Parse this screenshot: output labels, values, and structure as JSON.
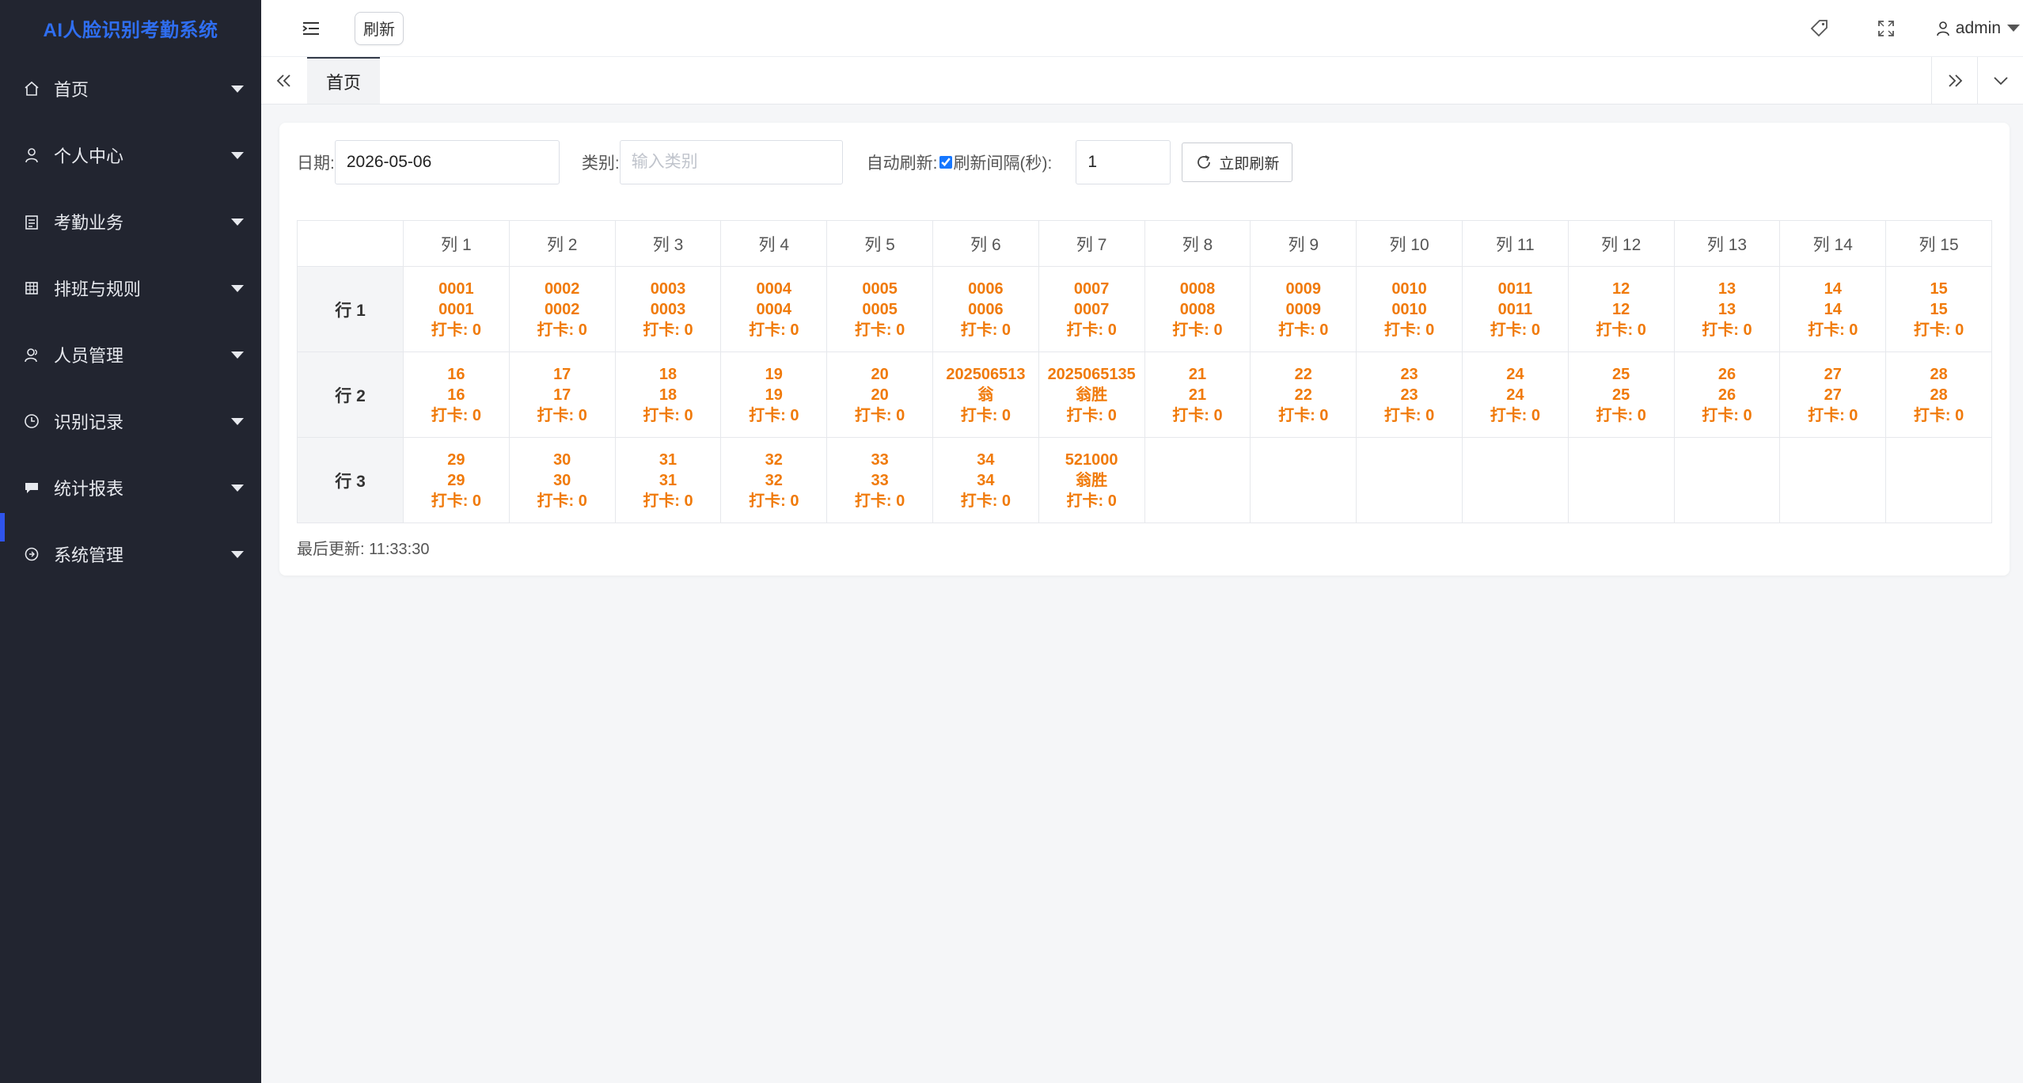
{
  "app": {
    "title": "AI人脸识别考勤系统"
  },
  "sidebar": {
    "items": [
      {
        "label": "首页",
        "icon": "home-icon"
      },
      {
        "label": "个人中心",
        "icon": "user-icon"
      },
      {
        "label": "考勤业务",
        "icon": "clipboard-icon"
      },
      {
        "label": "排班与规则",
        "icon": "grid-icon"
      },
      {
        "label": "人员管理",
        "icon": "users-icon"
      },
      {
        "label": "识别记录",
        "icon": "clock-icon"
      },
      {
        "label": "统计报表",
        "icon": "chat-icon"
      },
      {
        "label": "系统管理",
        "icon": "settings-icon"
      }
    ]
  },
  "header": {
    "refresh_label": "刷新",
    "user_name": "admin"
  },
  "tabs": [
    {
      "label": "首页"
    }
  ],
  "filters": {
    "date_label": "日期:",
    "date_value": "2026-05-06",
    "category_label": "类别:",
    "category_placeholder": "输入类别",
    "auto_refresh_label": "自动刷新:",
    "interval_label": "刷新间隔(秒):",
    "interval_value": "1",
    "refresh_now_label": "立即刷新",
    "auto_refresh_checked": true
  },
  "grid": {
    "columns": [
      "列 1",
      "列 2",
      "列 3",
      "列 4",
      "列 5",
      "列 6",
      "列 7",
      "列 8",
      "列 9",
      "列 10",
      "列 11",
      "列 12",
      "列 13",
      "列 14",
      "列 15"
    ],
    "rows": [
      {
        "label": "行 1",
        "cells": [
          [
            "0001",
            "0001",
            "打卡: 0"
          ],
          [
            "0002",
            "0002",
            "打卡: 0"
          ],
          [
            "0003",
            "0003",
            "打卡: 0"
          ],
          [
            "0004",
            "0004",
            "打卡: 0"
          ],
          [
            "0005",
            "0005",
            "打卡: 0"
          ],
          [
            "0006",
            "0006",
            "打卡: 0"
          ],
          [
            "0007",
            "0007",
            "打卡: 0"
          ],
          [
            "0008",
            "0008",
            "打卡: 0"
          ],
          [
            "0009",
            "0009",
            "打卡: 0"
          ],
          [
            "0010",
            "0010",
            "打卡: 0"
          ],
          [
            "0011",
            "0011",
            "打卡: 0"
          ],
          [
            "12",
            "12",
            "打卡: 0"
          ],
          [
            "13",
            "13",
            "打卡: 0"
          ],
          [
            "14",
            "14",
            "打卡: 0"
          ],
          [
            "15",
            "15",
            "打卡: 0"
          ]
        ]
      },
      {
        "label": "行 2",
        "cells": [
          [
            "16",
            "16",
            "打卡: 0"
          ],
          [
            "17",
            "17",
            "打卡: 0"
          ],
          [
            "18",
            "18",
            "打卡: 0"
          ],
          [
            "19",
            "19",
            "打卡: 0"
          ],
          [
            "20",
            "20",
            "打卡: 0"
          ],
          [
            "202506513",
            "翁",
            "打卡: 0"
          ],
          [
            "2025065135",
            "翁胜",
            "打卡: 0"
          ],
          [
            "21",
            "21",
            "打卡: 0"
          ],
          [
            "22",
            "22",
            "打卡: 0"
          ],
          [
            "23",
            "23",
            "打卡: 0"
          ],
          [
            "24",
            "24",
            "打卡: 0"
          ],
          [
            "25",
            "25",
            "打卡: 0"
          ],
          [
            "26",
            "26",
            "打卡: 0"
          ],
          [
            "27",
            "27",
            "打卡: 0"
          ],
          [
            "28",
            "28",
            "打卡: 0"
          ]
        ]
      },
      {
        "label": "行 3",
        "cells": [
          [
            "29",
            "29",
            "打卡: 0"
          ],
          [
            "30",
            "30",
            "打卡: 0"
          ],
          [
            "31",
            "31",
            "打卡: 0"
          ],
          [
            "32",
            "32",
            "打卡: 0"
          ],
          [
            "33",
            "33",
            "打卡: 0"
          ],
          [
            "34",
            "34",
            "打卡: 0"
          ],
          [
            "521000",
            "翁胜",
            "打卡: 0"
          ],
          null,
          null,
          null,
          null,
          null,
          null,
          null,
          null
        ]
      }
    ]
  },
  "status": {
    "last_updated": "最后更新: 11:33:30"
  },
  "colors": {
    "sidebar_bg": "#222530",
    "brand": "#2f6ef0",
    "cell_text": "#f07a0a",
    "active_indicator": "#2f54eb"
  }
}
